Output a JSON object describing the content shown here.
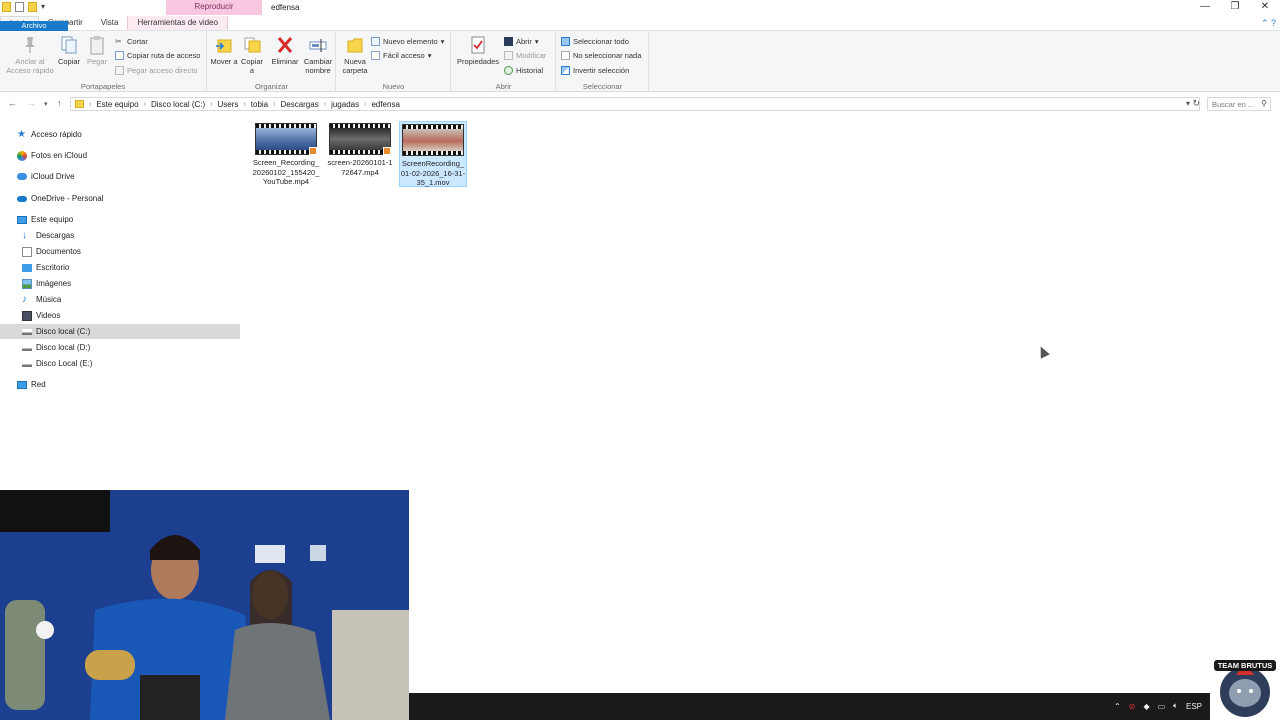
{
  "window": {
    "title": "edfensa",
    "contextual_tab": "Reproducir",
    "minimize": "—",
    "restore": "❐",
    "close": "✕"
  },
  "tabs": [
    "Archivo",
    "Inicio",
    "Compartir",
    "Vista",
    "Herramientas de video"
  ],
  "ribbon": {
    "portapapeles": {
      "label": "Portapapeles",
      "pin": "Anclar al Acceso rápido",
      "copy": "Copiar",
      "paste": "Pegar",
      "cut": "Cortar",
      "copy_path": "Copiar ruta de acceso",
      "paste_shortcut": "Pegar acceso directo"
    },
    "organizar": {
      "label": "Organizar",
      "move": "Mover a",
      "copy_to": "Copiar a",
      "delete": "Eliminar",
      "rename": "Cambiar nombre"
    },
    "nuevo": {
      "label": "Nuevo",
      "new_folder": "Nueva carpeta",
      "new_item": "Nuevo elemento",
      "easy_access": "Fácil acceso"
    },
    "abrir": {
      "label": "Abrir",
      "properties": "Propiedades",
      "open": "Abrir",
      "edit": "Modificar",
      "history": "Historial"
    },
    "seleccionar": {
      "label": "Seleccionar",
      "select_all": "Seleccionar todo",
      "select_none": "No seleccionar nada",
      "invert": "Invertir selección"
    }
  },
  "address": {
    "crumbs": [
      "Este equipo",
      "Disco local (C:)",
      "Users",
      "tobia",
      "Descargas",
      "jugadas",
      "edfensa"
    ],
    "search_placeholder": "Buscar en ..."
  },
  "nav": [
    {
      "label": "Acceso rápido",
      "icon": "star-icon"
    },
    {
      "label": "Fotos en iCloud",
      "icon": "photos-icon"
    },
    {
      "label": "iCloud Drive",
      "icon": "cloud-icon"
    },
    {
      "label": "OneDrive - Personal",
      "icon": "onedrive-icon"
    },
    {
      "label": "Este equipo",
      "icon": "computer-icon"
    },
    {
      "label": "Descargas",
      "icon": "download-icon"
    },
    {
      "label": "Documentos",
      "icon": "document-icon"
    },
    {
      "label": "Escritorio",
      "icon": "desktop-icon"
    },
    {
      "label": "Imágenes",
      "icon": "pictures-icon"
    },
    {
      "label": "Música",
      "icon": "music-icon"
    },
    {
      "label": "Videos",
      "icon": "video-icon"
    },
    {
      "label": "Disco local (C:)",
      "icon": "drive-icon"
    },
    {
      "label": "Disco local (D:)",
      "icon": "drive-icon"
    },
    {
      "label": "Disco Local (E:)",
      "icon": "drive-icon"
    },
    {
      "label": "Red",
      "icon": "network-icon"
    }
  ],
  "files": [
    {
      "name": "Screen_Recording_20260102_155420_YouTube.mp4",
      "selected": false
    },
    {
      "name": "screen-20260101-172647.mp4",
      "selected": false
    },
    {
      "name": "ScreenRecording_01-02-2026_16-31-35_1.mov",
      "selected": true
    }
  ],
  "tray": {
    "language": "ESP"
  },
  "overlay": {
    "logo_text": "TEAM BRUTUS"
  }
}
